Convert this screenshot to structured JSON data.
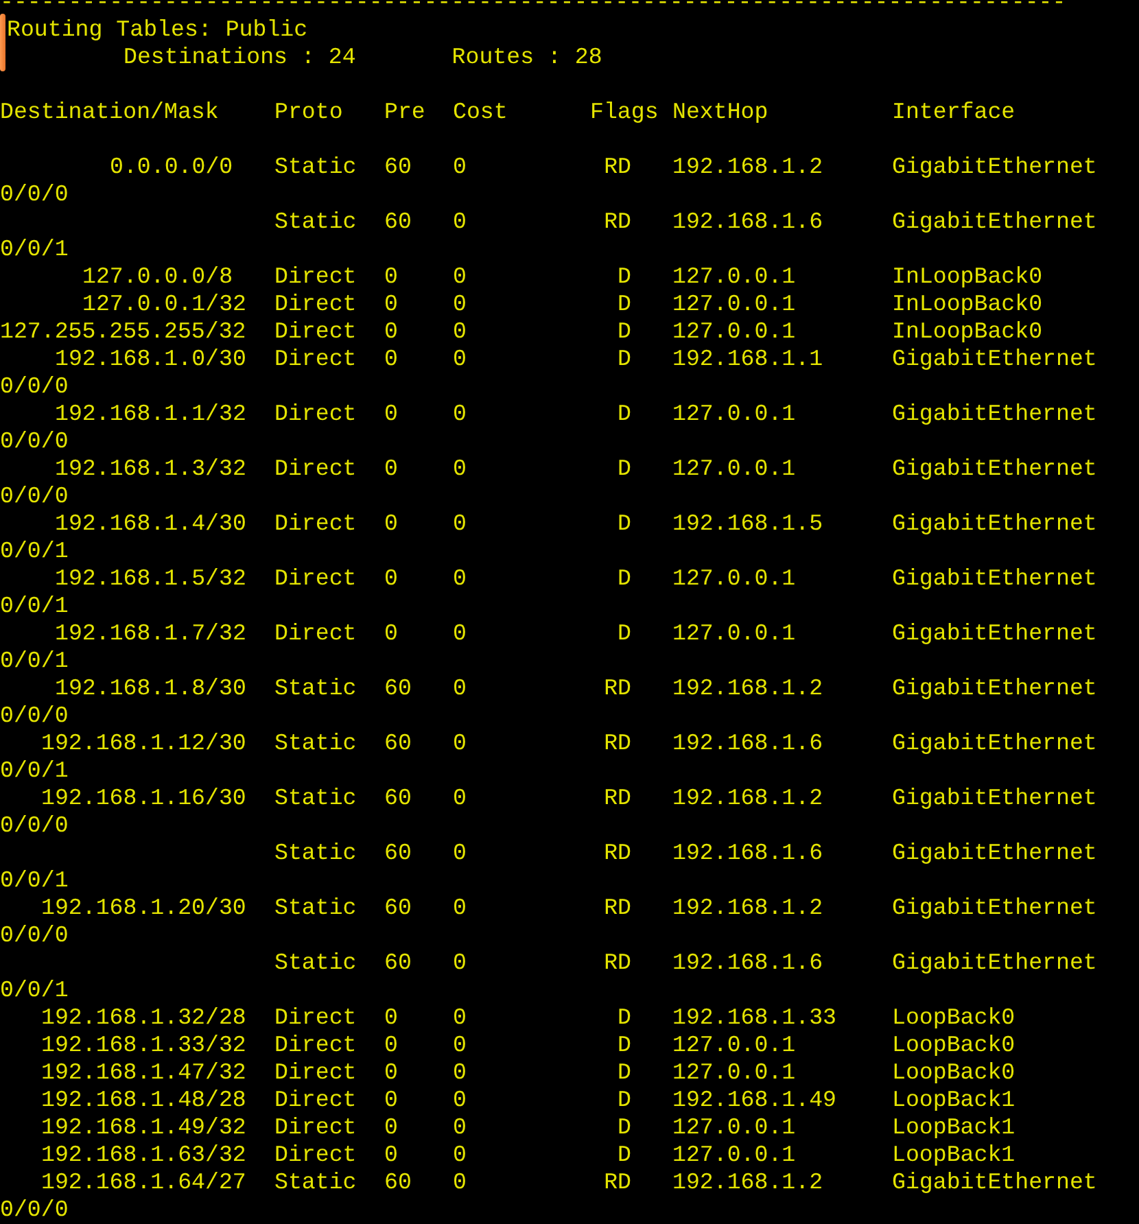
{
  "separator": "------------------------------------------------------------------------------",
  "title": "Routing Tables: Public",
  "summary": [
    "Destinations : 24",
    "Routes : 28"
  ],
  "columns": [
    "Destination/Mask",
    "Proto",
    "Pre",
    "Cost",
    "Flags",
    "NextHop",
    "Interface"
  ],
  "rows": [
    {
      "destination": "0.0.0.0/0",
      "proto": "Static",
      "pre": "60",
      "cost": "0",
      "flags": "RD",
      "nexthop": "192.168.1.2",
      "interface": "GigabitEthernet",
      "interface_wrap": "0/0/0"
    },
    {
      "proto": "Static",
      "pre": "60",
      "cost": "0",
      "flags": "RD",
      "nexthop": "192.168.1.6",
      "interface": "GigabitEthernet",
      "interface_wrap": "0/0/1"
    },
    {
      "destination": "127.0.0.0/8",
      "proto": "Direct",
      "pre": "0",
      "cost": "0",
      "flags": "D",
      "nexthop": "127.0.0.1",
      "interface": "InLoopBack0"
    },
    {
      "destination": "127.0.0.1/32",
      "proto": "Direct",
      "pre": "0",
      "cost": "0",
      "flags": "D",
      "nexthop": "127.0.0.1",
      "interface": "InLoopBack0"
    },
    {
      "destination": "127.255.255.255/32",
      "proto": "Direct",
      "pre": "0",
      "cost": "0",
      "flags": "D",
      "nexthop": "127.0.0.1",
      "interface": "InLoopBack0"
    },
    {
      "destination": "192.168.1.0/30",
      "proto": "Direct",
      "pre": "0",
      "cost": "0",
      "flags": "D",
      "nexthop": "192.168.1.1",
      "interface": "GigabitEthernet",
      "interface_wrap": "0/0/0"
    },
    {
      "destination": "192.168.1.1/32",
      "proto": "Direct",
      "pre": "0",
      "cost": "0",
      "flags": "D",
      "nexthop": "127.0.0.1",
      "interface": "GigabitEthernet",
      "interface_wrap": "0/0/0"
    },
    {
      "destination": "192.168.1.3/32",
      "proto": "Direct",
      "pre": "0",
      "cost": "0",
      "flags": "D",
      "nexthop": "127.0.0.1",
      "interface": "GigabitEthernet",
      "interface_wrap": "0/0/0"
    },
    {
      "destination": "192.168.1.4/30",
      "proto": "Direct",
      "pre": "0",
      "cost": "0",
      "flags": "D",
      "nexthop": "192.168.1.5",
      "interface": "GigabitEthernet",
      "interface_wrap": "0/0/1"
    },
    {
      "destination": "192.168.1.5/32",
      "proto": "Direct",
      "pre": "0",
      "cost": "0",
      "flags": "D",
      "nexthop": "127.0.0.1",
      "interface": "GigabitEthernet",
      "interface_wrap": "0/0/1"
    },
    {
      "destination": "192.168.1.7/32",
      "proto": "Direct",
      "pre": "0",
      "cost": "0",
      "flags": "D",
      "nexthop": "127.0.0.1",
      "interface": "GigabitEthernet",
      "interface_wrap": "0/0/1"
    },
    {
      "destination": "192.168.1.8/30",
      "proto": "Static",
      "pre": "60",
      "cost": "0",
      "flags": "RD",
      "nexthop": "192.168.1.2",
      "interface": "GigabitEthernet",
      "interface_wrap": "0/0/0"
    },
    {
      "destination": "192.168.1.12/30",
      "proto": "Static",
      "pre": "60",
      "cost": "0",
      "flags": "RD",
      "nexthop": "192.168.1.6",
      "interface": "GigabitEthernet",
      "interface_wrap": "0/0/1"
    },
    {
      "destination": "192.168.1.16/30",
      "proto": "Static",
      "pre": "60",
      "cost": "0",
      "flags": "RD",
      "nexthop": "192.168.1.2",
      "interface": "GigabitEthernet",
      "interface_wrap": "0/0/0"
    },
    {
      "proto": "Static",
      "pre": "60",
      "cost": "0",
      "flags": "RD",
      "nexthop": "192.168.1.6",
      "interface": "GigabitEthernet",
      "interface_wrap": "0/0/1"
    },
    {
      "destination": "192.168.1.20/30",
      "proto": "Static",
      "pre": "60",
      "cost": "0",
      "flags": "RD",
      "nexthop": "192.168.1.2",
      "interface": "GigabitEthernet",
      "interface_wrap": "0/0/0"
    },
    {
      "proto": "Static",
      "pre": "60",
      "cost": "0",
      "flags": "RD",
      "nexthop": "192.168.1.6",
      "interface": "GigabitEthernet",
      "interface_wrap": "0/0/1"
    },
    {
      "destination": "192.168.1.32/28",
      "proto": "Direct",
      "pre": "0",
      "cost": "0",
      "flags": "D",
      "nexthop": "192.168.1.33",
      "interface": "LoopBack0"
    },
    {
      "destination": "192.168.1.33/32",
      "proto": "Direct",
      "pre": "0",
      "cost": "0",
      "flags": "D",
      "nexthop": "127.0.0.1",
      "interface": "LoopBack0"
    },
    {
      "destination": "192.168.1.47/32",
      "proto": "Direct",
      "pre": "0",
      "cost": "0",
      "flags": "D",
      "nexthop": "127.0.0.1",
      "interface": "LoopBack0"
    },
    {
      "destination": "192.168.1.48/28",
      "proto": "Direct",
      "pre": "0",
      "cost": "0",
      "flags": "D",
      "nexthop": "192.168.1.49",
      "interface": "LoopBack1"
    },
    {
      "destination": "192.168.1.49/32",
      "proto": "Direct",
      "pre": "0",
      "cost": "0",
      "flags": "D",
      "nexthop": "127.0.0.1",
      "interface": "LoopBack1"
    },
    {
      "destination": "192.168.1.63/32",
      "proto": "Direct",
      "pre": "0",
      "cost": "0",
      "flags": "D",
      "nexthop": "127.0.0.1",
      "interface": "LoopBack1"
    },
    {
      "destination": "192.168.1.64/27",
      "proto": "Static",
      "pre": "60",
      "cost": "0",
      "flags": "RD",
      "nexthop": "192.168.1.2",
      "interface": "GigabitEthernet",
      "interface_wrap": "0/0/0"
    }
  ]
}
